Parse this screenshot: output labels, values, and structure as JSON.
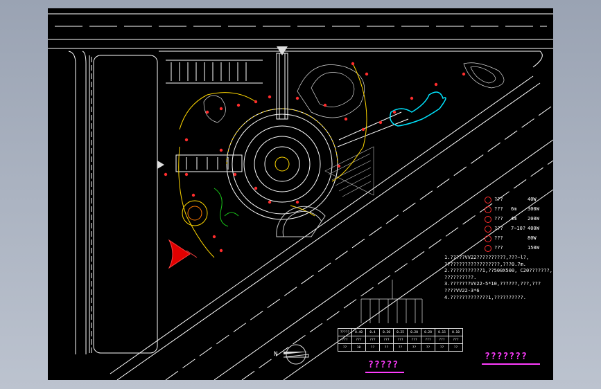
{
  "legend": [
    {
      "name": "???",
      "spec": "",
      "watt": "40W",
      "icon": "lamp-cross-icon"
    },
    {
      "name": "???",
      "spec": "6m",
      "watt": "300W",
      "icon": "street-lamp-icon"
    },
    {
      "name": "???",
      "spec": "4m",
      "watt": "200W",
      "icon": "garden-lamp-icon"
    },
    {
      "name": "???",
      "spec": "7~10?",
      "watt": "400W",
      "icon": "flood-lamp-icon"
    },
    {
      "name": "???",
      "spec": "",
      "watt": "80W",
      "icon": "lawn-lamp-icon"
    },
    {
      "name": "???",
      "spec": "",
      "watt": "150W",
      "icon": "spot-lamp-icon"
    }
  ],
  "notes": [
    "1.?????VV22??????????,???~l?,",
    "???????????????????,???0.7m.",
    "2.???????????1,??500X500, C20???????,",
    "??????????.",
    "3.???????VV22-5*10,??????,???,???",
    "????VV22-3*6",
    "4.?????????????1,??????????."
  ],
  "system_table": {
    "header": [
      "?????",
      "0.40",
      "0.4",
      "0.20",
      "0.25",
      "0.20",
      "0.28",
      "0.15",
      "0.10"
    ],
    "row2": [
      "???",
      "???",
      "???",
      "???",
      "???",
      "???",
      "???",
      "???",
      "???"
    ],
    "row3": [
      "??",
      "10",
      "??",
      "??",
      "??",
      "??",
      "??",
      "??",
      "??"
    ]
  },
  "titles": {
    "diagram_title": "?????",
    "drawing_title": "???????"
  },
  "colors": {
    "lamp": "#ff2d2d",
    "path": "#ffd700",
    "pond": "#00e5ff",
    "vegetation": "#19c419",
    "title": "#ff3cff"
  },
  "north_arrow": "N"
}
